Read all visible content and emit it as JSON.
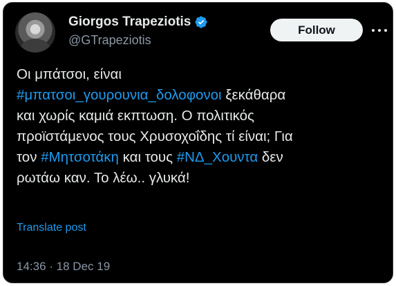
{
  "user": {
    "display_name": "Giorgos Trapeziotis",
    "handle": "@GTrapeziotis",
    "verified_icon": "verified-badge-icon"
  },
  "actions": {
    "follow_label": "Follow",
    "more_icon": "more-horizontal-icon"
  },
  "tweet": {
    "line1": "Οι μπάτσοι, είναι",
    "hashtag1": "#μπατσοι_γουρουνια_δολοφονοι",
    "line2_rest": " ξεκάθαρα",
    "line3": "και χωρίς καμιά εκπτωση. Ο πολιτικός",
    "line4": "προϊστάμενος τους Χρυσοχοΐδης τί είναι; Για",
    "line5_pre": "τον ",
    "hashtag2": "#Μητσοτάκη",
    "line5_mid": " και τους ",
    "hashtag3": "#ΝΔ_Χουντα",
    "line5_post": " δεν",
    "line6": "ρωτάω καν. Το λέω.. γλυκά!"
  },
  "translate_label": "Translate post",
  "meta": {
    "time": "14:36",
    "separator": " · ",
    "date": "18 Dec 19"
  },
  "colors": {
    "background": "#000000",
    "text": "#e7e9ea",
    "secondary": "#8b98a5",
    "link": "#1d9bf0",
    "button_bg": "#eff3f4"
  }
}
